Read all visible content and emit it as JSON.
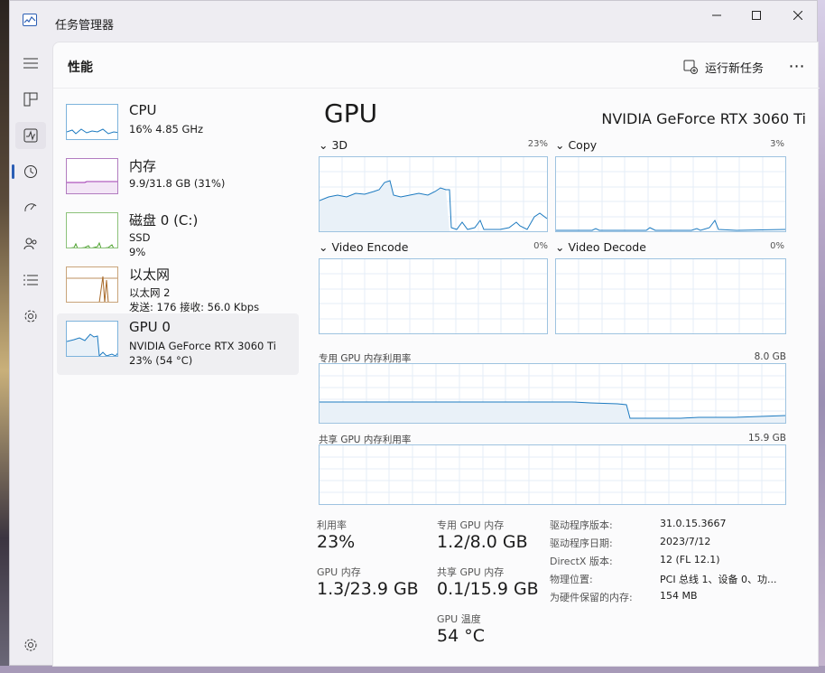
{
  "window": {
    "title": "任务管理器",
    "minimize": "minimize",
    "maximize": "maximize",
    "close": "close"
  },
  "header": {
    "page_title": "性能",
    "new_task": "运行新任务",
    "more": "⋯"
  },
  "nav": [
    {
      "icon": "hamburger-icon"
    },
    {
      "icon": "processes-icon"
    },
    {
      "icon": "performance-icon"
    },
    {
      "icon": "app-history-icon"
    },
    {
      "icon": "startup-icon"
    },
    {
      "icon": "users-icon"
    },
    {
      "icon": "details-icon"
    },
    {
      "icon": "services-icon"
    },
    {
      "icon": "settings-icon"
    }
  ],
  "resources": [
    {
      "name": "CPU",
      "l1": "16% 4.85 GHz",
      "l2": "",
      "l3": "",
      "color": "#1c7ac0"
    },
    {
      "name": "内存",
      "l1": "9.9/31.8 GB (31%)",
      "l2": "",
      "l3": "",
      "color": "#9b2fae"
    },
    {
      "name": "磁盘 0 (C:)",
      "l1": "SSD",
      "l2": "9%",
      "l3": "",
      "color": "#4ba02c"
    },
    {
      "name": "以太网",
      "l1": "以太网 2",
      "l2": "发送: 176 接收: 56.0 Kbps",
      "l3": "",
      "color": "#a86a2a"
    },
    {
      "name": "GPU 0",
      "l1": "NVIDIA GeForce RTX 3060 Ti",
      "l2": "23% (54 °C)",
      "l3": "",
      "color": "#1c7ac0"
    }
  ],
  "gpu": {
    "title": "GPU",
    "model": "NVIDIA GeForce RTX 3060 Ti",
    "engines": [
      {
        "name": "3D",
        "pct": "23%"
      },
      {
        "name": "Copy",
        "pct": "3%"
      },
      {
        "name": "Video Encode",
        "pct": "0%"
      },
      {
        "name": "Video Decode",
        "pct": "0%"
      }
    ],
    "dedicated_label": "专用 GPU 内存利用率",
    "dedicated_max": "8.0 GB",
    "shared_label": "共享 GPU 内存利用率",
    "shared_max": "15.9 GB",
    "stats": {
      "util_label": "利用率",
      "util": "23%",
      "gpumem_label": "GPU 内存",
      "gpumem": "1.3/23.9 GB",
      "ded_label": "专用 GPU 内存",
      "ded": "1.2/8.0 GB",
      "sh_label": "共享 GPU 内存",
      "sh": "0.1/15.9 GB",
      "temp_label": "GPU 温度",
      "temp": "54 °C"
    },
    "details": [
      {
        "k": "驱动程序版本:",
        "v": "31.0.15.3667"
      },
      {
        "k": "驱动程序日期:",
        "v": "2023/7/12"
      },
      {
        "k": "DirectX 版本:",
        "v": "12 (FL 12.1)"
      },
      {
        "k": "物理位置:",
        "v": "PCI 总线 1、设备 0、功..."
      },
      {
        "k": "为硬件保留的内存:",
        "v": "154 MB"
      }
    ]
  },
  "colors": {
    "accent": "#1c7ac0",
    "chart_border": "#9ec3e0",
    "chart_fill": "#e9f1f8"
  }
}
